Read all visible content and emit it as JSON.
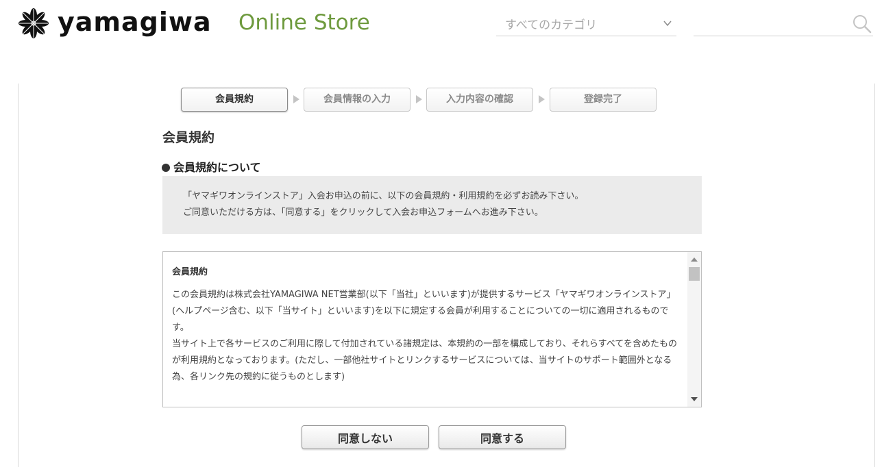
{
  "header": {
    "logo_word": "yamagiwa",
    "logo_sub": "Online Store",
    "category_select": {
      "selected": "すべてのカテゴリ"
    },
    "search": {
      "value": "",
      "placeholder": ""
    }
  },
  "steps": [
    {
      "label": "会員規約",
      "active": true
    },
    {
      "label": "会員情報の入力",
      "active": false
    },
    {
      "label": "入力内容の確認",
      "active": false
    },
    {
      "label": "登録完了",
      "active": false
    }
  ],
  "page_title": "会員規約",
  "section_title": "会員規約について",
  "notice": {
    "line1": "「ヤマギワオンラインストア」入会お申込の前に、以下の会員規約・利用規約を必ずお読み下さい。",
    "line2": "ご同意いただける方は、「同意する」をクリックして入会お申込フォームへお進み下さい。"
  },
  "terms": {
    "heading": "会員規約",
    "para1": "この会員規約は株式会社YAMAGIWA NET営業部(以下「当社」といいます)が提供するサービス「ヤマギワオンラインストア」(ヘルプページ含む、以下「当サイト」といいます)を以下に規定する会員が利用することについての一切に適用されるものです。",
    "para2": "当サイト上で各サービスのご利用に際して付加されている諸規定は、本規約の一部を構成しており、それらすべてを含めたものが利用規約となっております。(ただし、一部他社サイトとリンクするサービスについては、当サイトのサポート範囲外となる為、各リンク先の規約に従うものとします)"
  },
  "buttons": {
    "disagree": "同意しない",
    "agree": "同意する"
  },
  "colors": {
    "accent_green": "#6e9a3e",
    "notice_bg": "#ebebeb"
  }
}
